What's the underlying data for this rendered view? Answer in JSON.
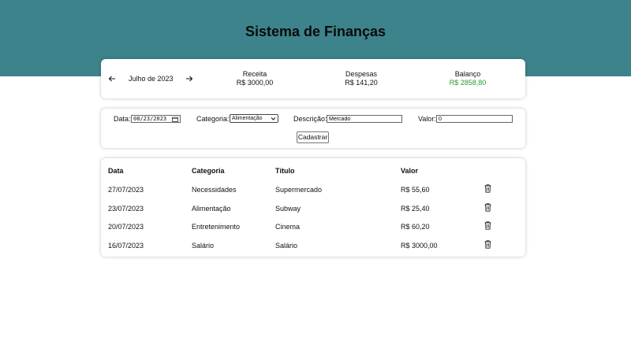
{
  "header": {
    "title": "Sistema de Finanças"
  },
  "summary": {
    "month": "Julho de 2023",
    "receita_label": "Receita",
    "receita_value": "R$ 3000,00",
    "despesas_label": "Despesas",
    "despesas_value": "R$ 141,20",
    "balanco_label": "Balanço",
    "balanco_value": "R$ 2858,80",
    "balanco_color": "#2a9a2a"
  },
  "form": {
    "date_label": "Data:",
    "date_value": "08/23/2023",
    "category_label": "Categoria:",
    "category_value": "Alimentação",
    "description_label": "Descrição:",
    "description_value": "Mercado",
    "value_label": "Valor:",
    "value_value": "0",
    "submit_label": "Cadastrar"
  },
  "table": {
    "headers": [
      "Data",
      "Categoria",
      "Título",
      "Valor"
    ],
    "rows": [
      {
        "date": "27/07/2023",
        "category": "Necessidades",
        "title": "Supermercado",
        "value": "R$ 55,60"
      },
      {
        "date": "23/07/2023",
        "category": "Alimentação",
        "title": "Subway",
        "value": "R$ 25,40"
      },
      {
        "date": "20/07/2023",
        "category": "Entretenimento",
        "title": "Cinema",
        "value": "R$ 60,20"
      },
      {
        "date": "16/07/2023",
        "category": "Salário",
        "title": "Salário",
        "value": "R$ 3000,00"
      }
    ]
  },
  "colors": {
    "header_band": "#3d838b",
    "positive": "#2a9a2a"
  },
  "icons": {
    "prev": "arrow-left-icon",
    "next": "arrow-right-icon",
    "delete": "trash-icon",
    "calendar": "calendar-icon"
  }
}
